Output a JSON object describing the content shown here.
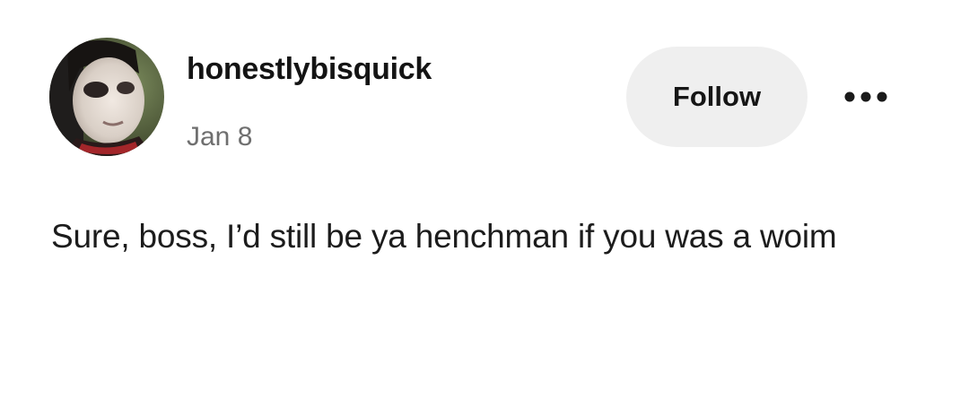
{
  "post": {
    "author": {
      "username": "honestlybisquick",
      "avatar_icon": "profile-photo"
    },
    "date": "Jan 8",
    "follow_label": "Follow",
    "more_icon": "ellipsis-icon",
    "text": "Sure, boss, I’d still be ya henchman if you was a woim"
  },
  "colors": {
    "background": "#ffffff",
    "follow_button_bg": "#efefef",
    "date_text": "#6f6f6f",
    "text": "#1c1c1c"
  }
}
